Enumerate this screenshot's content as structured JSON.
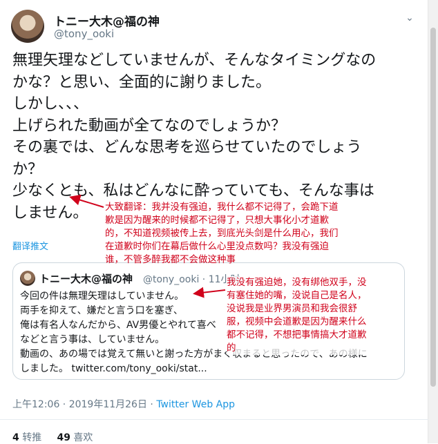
{
  "author": {
    "display_name": "トニー大木@福の神",
    "handle": "@tony_ooki"
  },
  "tweet": {
    "lines": [
      "無理矢理などしていませんが、そんなタイミングなの",
      "かな？と思い、全面的に謝りました。",
      "しかし、、、",
      "上げられた動画が全てなのでしょうか？",
      "その裏では、どんな思考を巡らせていたのでしょう",
      "か？",
      "少なくとも、私はどんなに酔っていても、そんな事は",
      "しません。"
    ],
    "translate_label": "翻译推文"
  },
  "quoted": {
    "display_name": "トニー大木@福の神",
    "handle_time": "@tony_ooki · 11小时",
    "lines": [
      "今回の件は無理矢理はしていません。",
      "両手を抑えて、嫌だと言う口を塞ぎ、",
      "俺は有名人なんだから、AV男優とやれて喜べ",
      "などと言う事は、していません。",
      "動画の、あの場では覚えて無いと謝った方がまく収まると思ったので、あの様に",
      "しました。 twitter.com/tony_ooki/stat..."
    ]
  },
  "meta": {
    "time": "上午12:06 · 2019年11月26日 · ",
    "source": "Twitter Web App"
  },
  "stats": {
    "retweets": "4",
    "retweets_label": " 转推",
    "likes": "49",
    "likes_label": " 喜欢"
  },
  "annotations": {
    "first": [
      "大致翻译：我并没有强迫，我什么都不记得了，会跪下道",
      "歉是因为醒来的时候都不记得了，只想大事化小才道歉",
      "的，不知道视频被传上去，到底光头剑是什么用心，我们",
      "在道歉时你们在幕后做什么心里没点数吗？我没有强迫",
      "谁，不管多醉我都不会做这种事"
    ],
    "second": [
      "我没有强迫她，没有绑他双手，没",
      "有塞住她的嘴，没说自己是名人，",
      "没说我是业界男演员和我会很舒",
      "服，视频中会道歉是因为醒来什么",
      "都不记得，不想把事情搞大才道歉",
      "的"
    ]
  },
  "colors": {
    "annotation": "#d0021b",
    "link": "#1b95e0",
    "secondary": "#657786"
  }
}
